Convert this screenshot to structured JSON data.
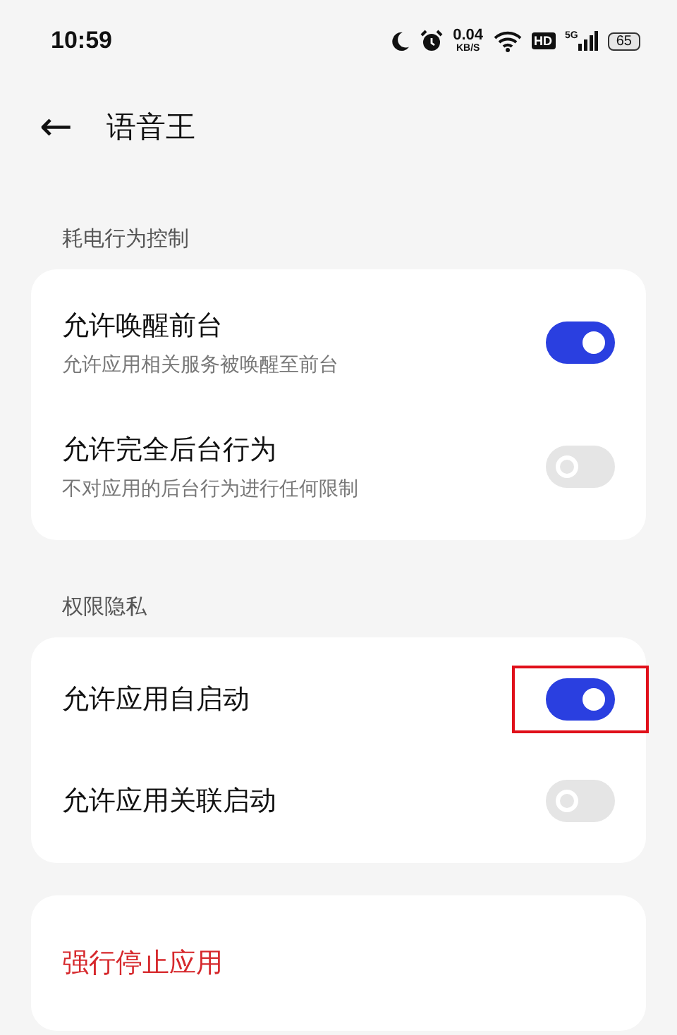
{
  "status_bar": {
    "time": "10:59",
    "speed_value": "0.04",
    "speed_unit": "KB/S",
    "hd": "HD",
    "network": "5G",
    "battery": "65"
  },
  "header": {
    "back": "←",
    "title": "语音王"
  },
  "sections": [
    {
      "label": "耗电行为控制",
      "items": [
        {
          "title": "允许唤醒前台",
          "subtitle": "允许应用相关服务被唤醒至前台",
          "on": true,
          "highlighted": false
        },
        {
          "title": "允许完全后台行为",
          "subtitle": "不对应用的后台行为进行任何限制",
          "on": false,
          "highlighted": false
        }
      ]
    },
    {
      "label": "权限隐私",
      "items": [
        {
          "title": "允许应用自启动",
          "on": true,
          "highlighted": true
        },
        {
          "title": "允许应用关联启动",
          "on": false,
          "highlighted": false
        }
      ]
    }
  ],
  "danger_action": {
    "label": "强行停止应用"
  }
}
